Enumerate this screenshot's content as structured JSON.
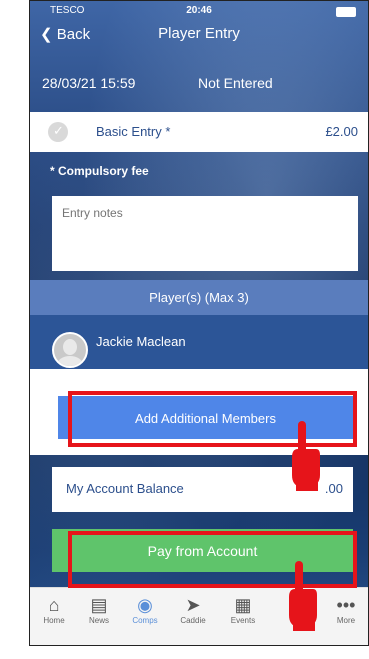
{
  "status_bar": {
    "carrier": "TESCO",
    "time": "20:46"
  },
  "nav": {
    "back_label": "Back",
    "title": "Player Entry"
  },
  "entry": {
    "datetime": "28/03/21 15:59",
    "status": "Not Entered"
  },
  "fee": {
    "label": "Basic Entry *",
    "price": "£2.00"
  },
  "compulsory_note": "* Compulsory fee",
  "notes": {
    "placeholder": "Entry notes"
  },
  "players": {
    "header": "Player(s) (Max 3)",
    "members": [
      {
        "name": "Jackie Maclean"
      }
    ]
  },
  "add_members_label": "Add Additional Members",
  "balance": {
    "label": "My Account Balance",
    "value": ".00"
  },
  "pay_label": "Pay from Account",
  "tabs": [
    {
      "label": "Home",
      "icon": "home-icon"
    },
    {
      "label": "News",
      "icon": "news-icon"
    },
    {
      "label": "Comps",
      "icon": "medal-icon"
    },
    {
      "label": "Caddie",
      "icon": "caddie-icon"
    },
    {
      "label": "Events",
      "icon": "calendar-icon"
    },
    {
      "label": "pp",
      "icon": "app-icon"
    },
    {
      "label": "More",
      "icon": "more-icon"
    }
  ],
  "colors": {
    "primary_blue": "#2c4f8c",
    "accent_blue": "#4f86e8",
    "pay_green": "#5fc46b",
    "highlight_red": "#e6141a"
  }
}
